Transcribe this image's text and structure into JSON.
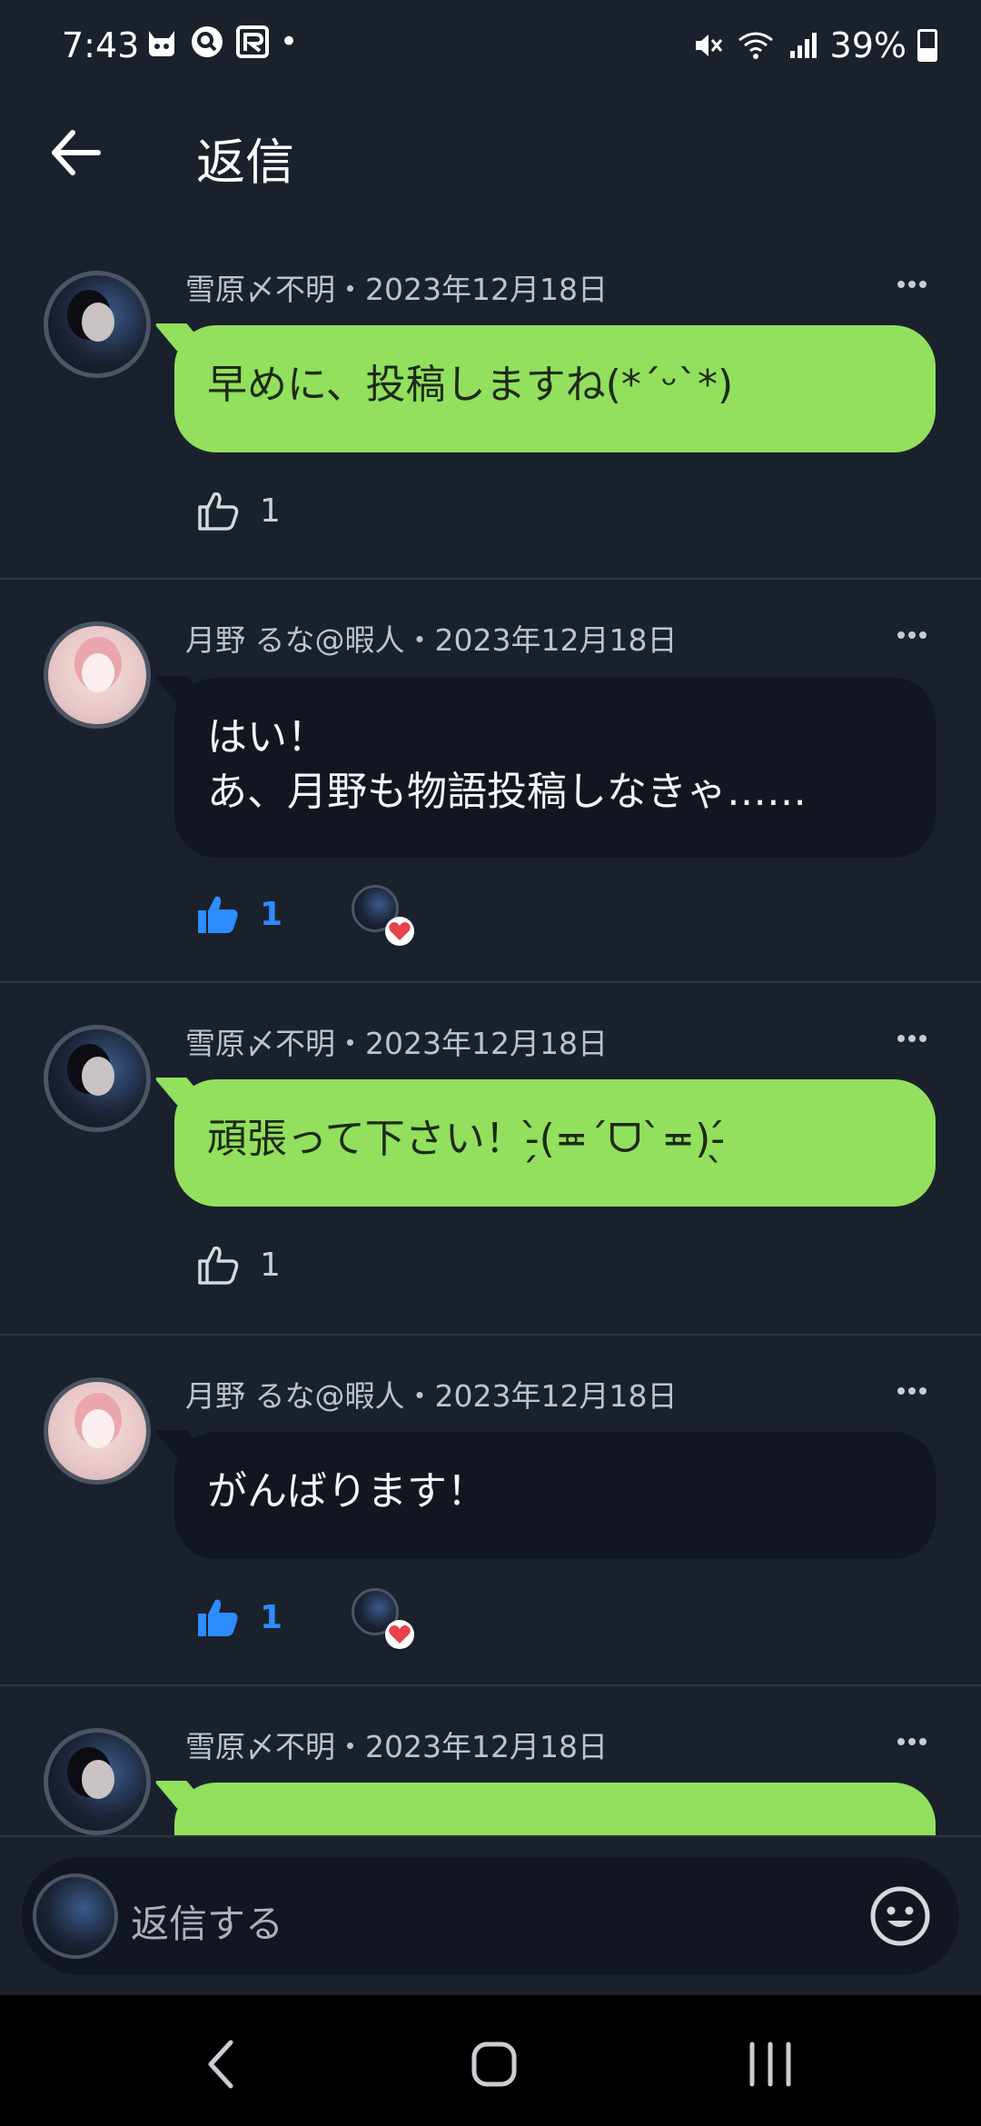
{
  "status_bar": {
    "time": "7:43",
    "notification_icons": [
      "cat-app-icon",
      "search-app-icon",
      "r-app-icon"
    ],
    "notification_dot": "•",
    "battery": "39%"
  },
  "header": {
    "title": "返信"
  },
  "comments": [
    {
      "author": "雪原〆不明",
      "date": "2023年12月18日",
      "meta": "雪原〆不明・2023年12月18日",
      "text": "早めに、投稿しますね(*´ᵕ`*)",
      "bubble_style": "green",
      "likes": "1",
      "liked": false
    },
    {
      "author": "月野 るな@暇人",
      "date": "2023年12月18日",
      "meta": "月野 るな@暇人・2023年12月18日",
      "text": "はい！\nあ、月野も物語投稿しなきゃ……",
      "bubble_style": "dark",
      "likes": "1",
      "liked": true
    },
    {
      "author": "雪原〆不明",
      "date": "2023年12月18日",
      "meta": "雪原〆不明・2023年12月18日",
      "text": "頑張って下さい！-̗̀(≖´ᗜ`≖)-̖́",
      "bubble_style": "green",
      "likes": "1",
      "liked": false
    },
    {
      "author": "月野 るな@暇人",
      "date": "2023年12月18日",
      "meta": "月野 るな@暇人・2023年12月18日",
      "text": "がんばります！",
      "bubble_style": "dark",
      "likes": "1",
      "liked": true
    },
    {
      "author": "雪原〆不明",
      "date": "2023年12月18日",
      "meta": "雪原〆不明・2023年12月18日",
      "bubble_style": "green"
    }
  ],
  "reply_bar": {
    "placeholder": "返信する"
  },
  "colors": {
    "background": "#1a212c",
    "bubble_green": "#92e05d",
    "bubble_dark": "#111620",
    "like_active": "#2d8cff",
    "heart": "#e8424b"
  }
}
